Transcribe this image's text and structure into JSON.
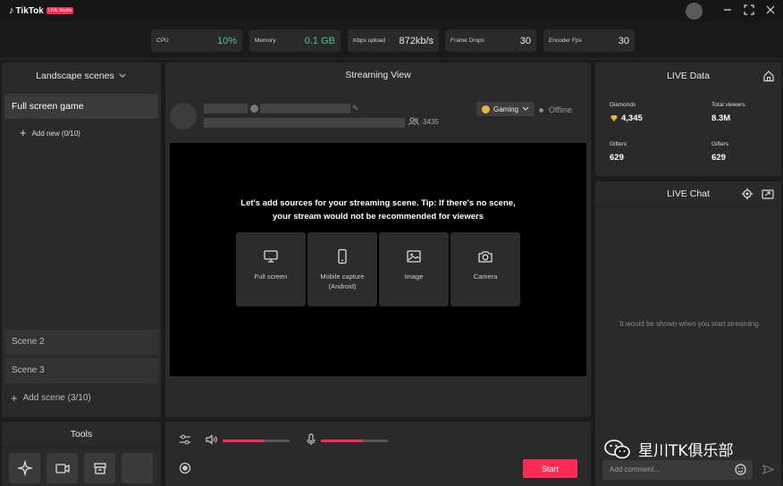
{
  "app": {
    "title": "TikTok",
    "badge": "LIVE Studio"
  },
  "stats": [
    {
      "label": "CPU",
      "value": "10%"
    },
    {
      "label": "Memory",
      "value": "0.1 GB"
    },
    {
      "label": "Kbps upload",
      "value": "872kb/s"
    },
    {
      "label": "Frame Drops",
      "value": "30"
    },
    {
      "label": "Encoder Fps",
      "value": "30"
    }
  ],
  "scenes": {
    "header": "Landscape scenes",
    "active": "Full screen game",
    "add_new": "Add new (0/10)",
    "others": [
      "Scene 2",
      "Scene 3"
    ],
    "add_scene": "Add scene (3/10)"
  },
  "tools": {
    "header": "Tools"
  },
  "stream": {
    "header": "Streaming View",
    "viewer_count": "3435",
    "category": "Gaming",
    "status": "Offline",
    "tip": "Let's add sources for your streaming scene. Tip: If there's no scene, your stream would not be recommended for viewers",
    "sources": [
      {
        "label": "Full screen",
        "icon": "monitor-icon"
      },
      {
        "label": "Mobile capture (Android)",
        "icon": "phone-icon"
      },
      {
        "label": "Image",
        "icon": "image-icon"
      },
      {
        "label": "Camera",
        "icon": "camera-icon"
      }
    ]
  },
  "controls": {
    "start_label": "Start",
    "speaker_level": 0.62,
    "mic_level": 0.62
  },
  "live_data": {
    "header": "LIVE Data",
    "diamonds_label": "Diamonds",
    "diamonds_value": "4,345",
    "viewers_label": "Total viewers",
    "viewers_value": "8.3M",
    "gifters1_label": "Gifters",
    "gifters1_value": "629",
    "gifters2_label": "Gifters",
    "gifters2_value": "629"
  },
  "live_chat": {
    "header": "LIVE Chat",
    "empty": "It would be shown when you start streaming",
    "placeholder": "Add comment..."
  },
  "watermark": "星川TK俱乐部",
  "colors": {
    "accent": "#fe2c55",
    "good": "#53c28b"
  }
}
